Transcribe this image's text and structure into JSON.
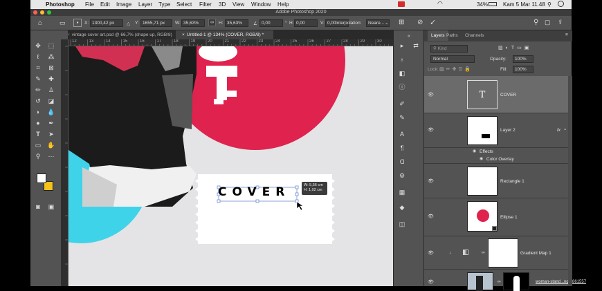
{
  "menubar": {
    "app_name": "Photoshop",
    "items": [
      "File",
      "Edit",
      "Image",
      "Layer",
      "Type",
      "Select",
      "Filter",
      "3D",
      "View",
      "Window",
      "Help"
    ],
    "battery": "34%",
    "clock": "Kam 5 Mar  11.48"
  },
  "window": {
    "title": "Adobe Photoshop 2020"
  },
  "options_bar": {
    "x_label": "X:",
    "x_value": "1300,42 px",
    "y_label": "Y:",
    "y_value": "1655,71 px",
    "w_label": "W:",
    "w_value": "35,63%",
    "h_label": "H:",
    "h_value": "35,63%",
    "angle_value": "0,00",
    "hskew_label": "H:",
    "hskew_value": "0,00",
    "vskew_label": "V:",
    "vskew_value": "0,00",
    "interp_label": "Interpolation:",
    "interp_value": "Neare..."
  },
  "doc_tabs": [
    {
      "label": "vintage cover art.psd @ 66,7% (shape up, RGB/8)"
    },
    {
      "label": "Untitled-1 @ 134% (COVER, RGB/8) *"
    }
  ],
  "ruler": {
    "h_ticks": [
      "12",
      "13",
      "14",
      "15",
      "16",
      "17",
      "18",
      "19",
      "20",
      "21",
      "22",
      "23",
      "24",
      "25",
      "26",
      "27",
      "28",
      "29",
      "30"
    ]
  },
  "canvas": {
    "headline": "COVER",
    "transform_tooltip": {
      "w": "W: 5,56 cm",
      "h": "H: 1,02 cm"
    }
  },
  "panel": {
    "tabs": [
      "Layers",
      "Paths",
      "Channels"
    ],
    "kind_placeholder": "Kind",
    "blend_mode": "Normal",
    "opacity_label": "Opacity:",
    "opacity_value": "100%",
    "lock_label": "Lock:",
    "fill_label": "Fill:",
    "fill_value": "100%",
    "layers": {
      "cover": "COVER",
      "layer2": "Layer 2",
      "fx": "fx",
      "effects": "Effects",
      "color_overlay": "Color Overlay",
      "rect1": "Rectangle 1",
      "ellipse1": "Ellipse 1",
      "gradmap": "Gradient Map 1",
      "woman": "woman-stand...ng-2861557"
    },
    "thumb_text": "T"
  },
  "colors": {
    "accent_red": "#e0224e",
    "accent_cyan": "#3fd3ea",
    "fg_swatch": "#ffffff",
    "bg_swatch": "#f7c21a"
  }
}
